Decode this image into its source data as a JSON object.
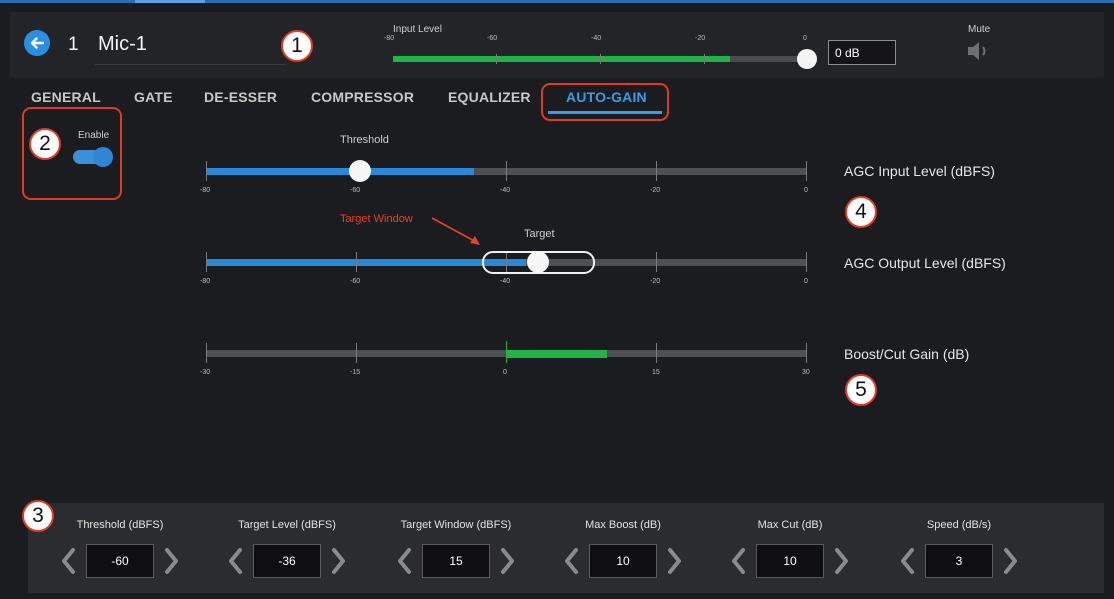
{
  "header": {
    "channel_number": "1",
    "channel_name": "Mic-1",
    "input_level_label": "Input Level",
    "input_ticks": [
      "-80",
      "-60",
      "-40",
      "-20",
      "0"
    ],
    "input_level_value": "0 dB",
    "input_meter_fill": 0.81,
    "mute_label": "Mute"
  },
  "tabs": [
    "GENERAL",
    "GATE",
    "DE-ESSER",
    "COMPRESSOR",
    "EQUALIZER",
    "AUTO-GAIN"
  ],
  "active_tab": "AUTO-GAIN",
  "enable": {
    "label": "Enable",
    "on": true
  },
  "callouts": [
    "1",
    "2",
    "3",
    "4",
    "5"
  ],
  "agc_input": {
    "label": "AGC Input Level (dBFS)",
    "slider_label": "Threshold",
    "ticks": [
      "-80",
      "-60",
      "-40",
      "-20",
      "0"
    ],
    "threshold": -60,
    "level": -44
  },
  "agc_output": {
    "label": "AGC Output Level (dBFS)",
    "slider_label": "Target",
    "annotation": "Target Window",
    "ticks": [
      "-80",
      "-60",
      "-40",
      "-20",
      "0"
    ],
    "target": -36,
    "window": 15,
    "level": -40
  },
  "boost_cut": {
    "label": "Boost/Cut Gain (dB)",
    "ticks": [
      "-30",
      "-15",
      "0",
      "15",
      "30"
    ],
    "gain": 10
  },
  "params": [
    {
      "label": "Threshold (dBFS)",
      "value": "-60"
    },
    {
      "label": "Target Level (dBFS)",
      "value": "-36"
    },
    {
      "label": "Target Window (dBFS)",
      "value": "15"
    },
    {
      "label": "Max Boost (dB)",
      "value": "10"
    },
    {
      "label": "Max Cut (dB)",
      "value": "10"
    },
    {
      "label": "Speed (dB/s)",
      "value": "3"
    }
  ],
  "colors": {
    "accent": "#2b88d9",
    "meter_green": "#21b24a",
    "callout_red": "#e03a23"
  },
  "icons": [
    "back-arrow-icon",
    "speaker-icon",
    "chevron-left-icon",
    "chevron-right-icon"
  ]
}
